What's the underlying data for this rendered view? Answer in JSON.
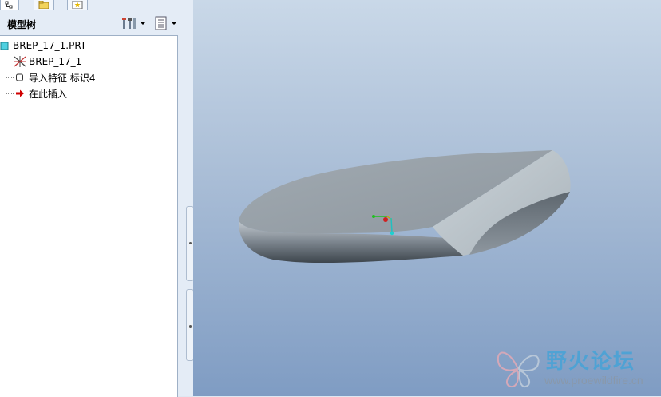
{
  "tree_panel": {
    "title": "模型树",
    "items": [
      {
        "label": "BREP_17_1.PRT",
        "icon": "part-icon"
      },
      {
        "label": "BREP_17_1",
        "icon": "datum-csys-icon"
      },
      {
        "label": "导入特征 标识4",
        "icon": "import-feature-icon"
      },
      {
        "label": "在此插入",
        "icon": "insert-here-arrow-icon"
      }
    ],
    "tools": [
      {
        "name": "settings-tool-icon"
      },
      {
        "name": "show-list-icon"
      }
    ]
  },
  "tabs": [
    {
      "name": "model-tree-tab",
      "icon": "tree-icon"
    },
    {
      "name": "folder-browser-tab",
      "icon": "folder-icon"
    },
    {
      "name": "favorites-tab",
      "icon": "star-icon"
    }
  ],
  "watermark": {
    "title": "野火论坛",
    "url": "www.proewildfire.cn"
  },
  "colors": {
    "viewport_top": "#c9d8e8",
    "viewport_bottom": "#7f9cc3",
    "part_shade": "#9aa3ab",
    "insert_arrow": "#d00000"
  }
}
